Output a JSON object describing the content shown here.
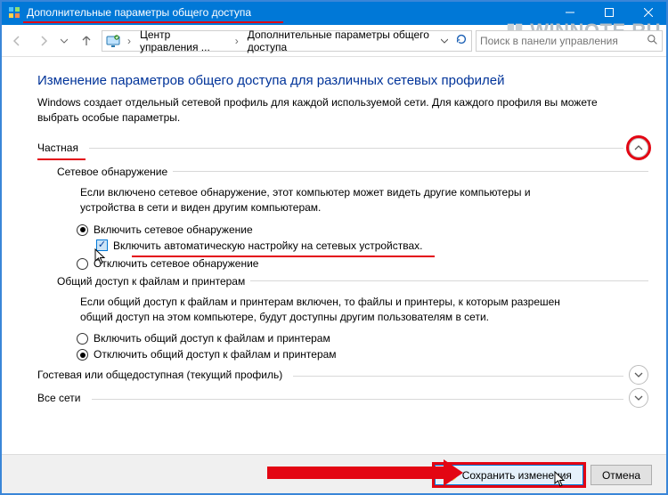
{
  "window": {
    "title": "Дополнительные параметры общего доступа"
  },
  "watermark": "WINNOTE RU",
  "nav": {
    "crumb1": "Центр управления ...",
    "crumb2": "Дополнительные параметры общего доступа",
    "search_placeholder": "Поиск в панели управления"
  },
  "heading": "Изменение параметров общего доступа для различных сетевых профилей",
  "description": "Windows создает отдельный сетевой профиль для каждой используемой сети. Для каждого профиля вы можете выбрать особые параметры.",
  "sections": {
    "private": {
      "label": "Частная",
      "network_discovery": {
        "title": "Сетевое обнаружение",
        "text": "Если включено сетевое обнаружение, этот компьютер может видеть другие компьютеры и устройства в сети и виден другим компьютерам.",
        "enable": "Включить сетевое обнаружение",
        "auto": "Включить автоматическую настройку на сетевых устройствах.",
        "disable": "Отключить сетевое обнаружение"
      },
      "file_printer": {
        "title": "Общий доступ к файлам и принтерам",
        "text": "Если общий доступ к файлам и принтерам включен, то файлы и принтеры, к которым разрешен общий доступ на этом компьютере, будут доступны другим пользователям в сети.",
        "enable": "Включить общий доступ к файлам и принтерам",
        "disable": "Отключить общий доступ к файлам и принтерам"
      }
    },
    "guest": {
      "label": "Гостевая или общедоступная (текущий профиль)"
    },
    "all": {
      "label": "Все сети"
    }
  },
  "footer": {
    "save": "Сохранить изменения",
    "cancel": "Отмена"
  }
}
